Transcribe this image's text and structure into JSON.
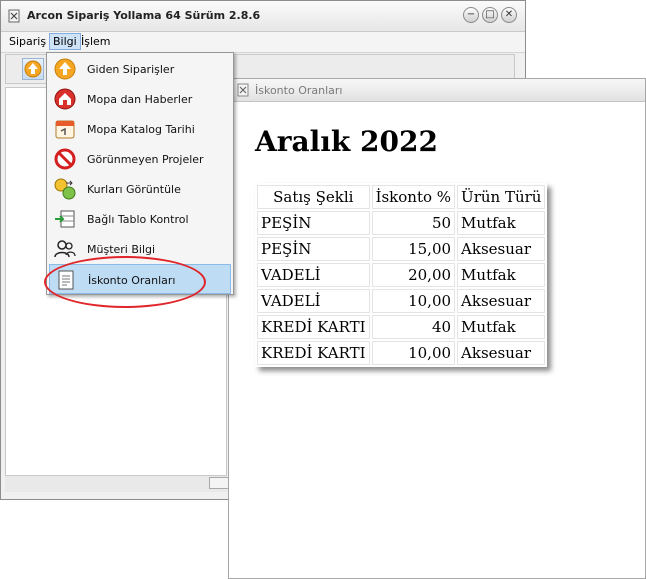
{
  "app": {
    "title": "Arcon Sipariş Yollama 64  Sürüm 2.8.6",
    "controls": {
      "minimize": "−",
      "maximize": "□",
      "close": "✕"
    }
  },
  "menubar": {
    "items": [
      {
        "label": "Sipariş"
      },
      {
        "label": "Bilgi"
      },
      {
        "label": "İşlem"
      }
    ]
  },
  "dropdown": {
    "items": [
      {
        "label": "Giden Siparişler",
        "icon": "upload-arrow-icon"
      },
      {
        "label": "Mopa dan Haberler",
        "icon": "home-icon"
      },
      {
        "label": "Mopa Katalog Tarihi",
        "icon": "calendar-icon"
      },
      {
        "label": "Görünmeyen Projeler",
        "icon": "prohibited-icon"
      },
      {
        "label": "Kurları Görüntüle",
        "icon": "currency-icon"
      },
      {
        "label": "Bağlı Tablo Kontrol",
        "icon": "table-arrow-icon"
      },
      {
        "label": "Müşteri Bilgi",
        "icon": "users-icon"
      },
      {
        "label": "İskonto Oranları",
        "icon": "document-list-icon"
      }
    ]
  },
  "child_window": {
    "title": "İskonto Oranları",
    "heading": "Aralık 2022",
    "table": {
      "headers": [
        "Satış Şekli",
        "İskonto %",
        "Ürün Türü"
      ],
      "rows": [
        [
          "PEŞİN",
          "50",
          "Mutfak"
        ],
        [
          "PEŞİN",
          "15,00",
          "Aksesuar"
        ],
        [
          "VADELİ",
          "20,00",
          "Mutfak"
        ],
        [
          "VADELİ",
          "10,00",
          "Aksesuar"
        ],
        [
          "KREDİ KARTI",
          "40",
          "Mutfak"
        ],
        [
          "KREDİ KARTI",
          "10,00",
          "Aksesuar"
        ]
      ]
    }
  },
  "colors": {
    "highlight": "#bfdcf5",
    "annotation": "#e0262a"
  }
}
